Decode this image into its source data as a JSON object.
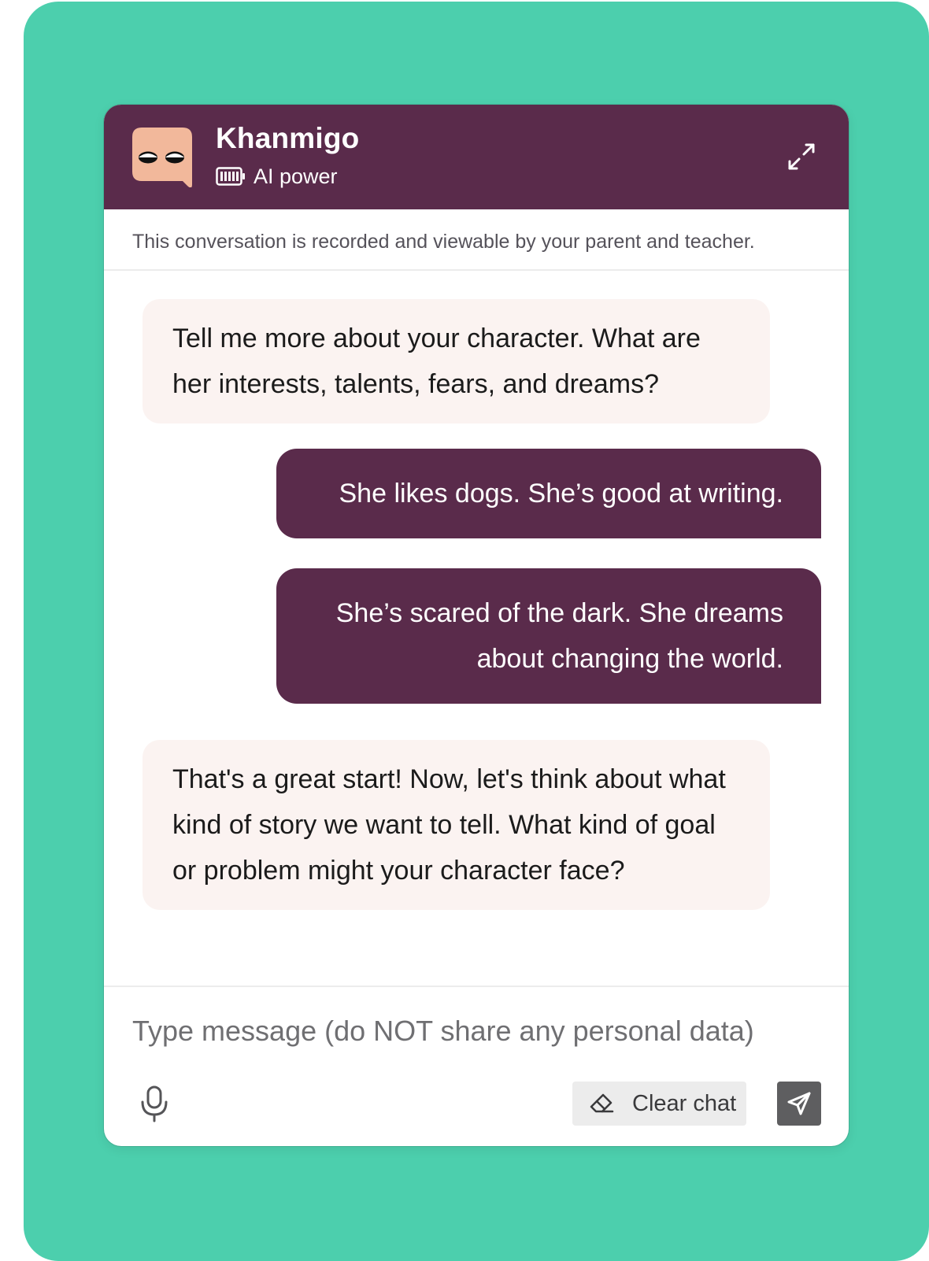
{
  "header": {
    "title": "Khanmigo",
    "power_label": "AI power",
    "avatar_icon": "khanmigo-face-icon",
    "battery_icon": "battery-full-icon",
    "expand_icon": "expand-arrows-icon"
  },
  "notice": "This conversation is recorded and viewable by your parent and teacher.",
  "messages": [
    {
      "role": "assistant",
      "text": "Tell me more about your character. What are her interests, talents, fears, and dreams?"
    },
    {
      "role": "user",
      "text": "She likes dogs. She’s good at writing."
    },
    {
      "role": "user",
      "text": "She’s scared of the dark. She dreams about changing the world."
    },
    {
      "role": "assistant",
      "text": "That's a great start! Now, let's think about what kind of story we want to tell. What kind of goal or problem might your character face?"
    }
  ],
  "composer": {
    "placeholder": "Type message (do NOT share any personal data)",
    "value": "",
    "clear_label": "Clear chat",
    "mic_icon": "microphone-icon",
    "eraser_icon": "eraser-icon",
    "send_icon": "send-icon"
  },
  "colors": {
    "background": "#4ccfad",
    "header": "#5a2b4b",
    "user_bubble": "#5a2b4b",
    "assistant_bubble": "#fbf3f1",
    "avatar": "#f2b89b",
    "send_button": "#5e5e60"
  }
}
